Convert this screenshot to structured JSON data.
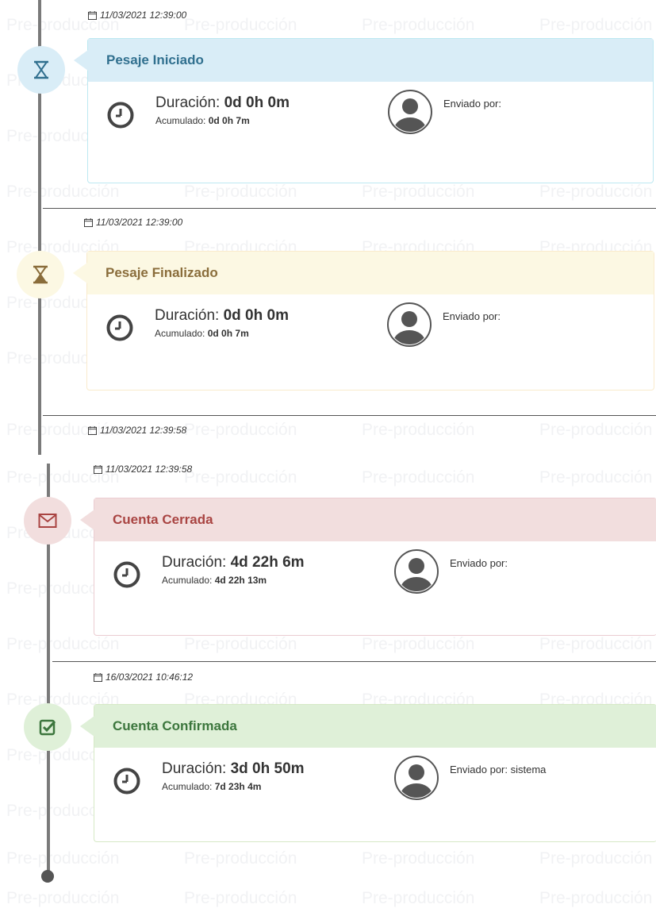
{
  "watermark_text": "Pre-producción",
  "colors": {
    "blue_bg": "#d9edf7",
    "blue_border": "#bce8f1",
    "blue_text": "#31708f",
    "yellow_bg": "#fcf8e3",
    "yellow_border": "#faebcc",
    "yellow_text": "#8a6d3b",
    "red_bg": "#f2dede",
    "red_border": "#ebccd1",
    "red_text": "#a94442",
    "green_bg": "#dff0d8",
    "green_border": "#d6e9c6",
    "green_text": "#3c763d"
  },
  "events": [
    {
      "date": "11/03/2021 12:39:00",
      "title": "Pesaje Iniciado",
      "icon": "hourglass-icon",
      "duration_label": "Duración:",
      "duration_value": "0d 0h 0m",
      "accumulated_label": "Acumulado:",
      "accumulated_value": "0d 0h 7m",
      "sent_label": "Enviado por:",
      "sent_value": ""
    },
    {
      "date": "11/03/2021 12:39:00",
      "title": "Pesaje Finalizado",
      "icon": "hourglass-end-icon",
      "duration_label": "Duración:",
      "duration_value": "0d 0h 0m",
      "accumulated_label": "Acumulado:",
      "accumulated_value": "0d 0h 7m",
      "sent_label": "Enviado por:",
      "sent_value": ""
    },
    {
      "date": "11/03/2021 12:39:58",
      "title": "",
      "icon": "",
      "duration_label": "",
      "duration_value": "",
      "accumulated_label": "",
      "accumulated_value": "",
      "sent_label": "",
      "sent_value": ""
    },
    {
      "date": "11/03/2021 12:39:58",
      "title": "Cuenta Cerrada",
      "icon": "envelope-icon",
      "duration_label": "Duración:",
      "duration_value": "4d 22h 6m",
      "accumulated_label": "Acumulado:",
      "accumulated_value": "4d 22h 13m",
      "sent_label": "Enviado por:",
      "sent_value": ""
    },
    {
      "date": "16/03/2021 10:46:12",
      "title": "Cuenta Confirmada",
      "icon": "check-square-icon",
      "duration_label": "Duración:",
      "duration_value": "3d 0h 50m",
      "accumulated_label": "Acumulado:",
      "accumulated_value": "7d 23h 4m",
      "sent_label": "Enviado por:",
      "sent_value": "sistema"
    }
  ]
}
